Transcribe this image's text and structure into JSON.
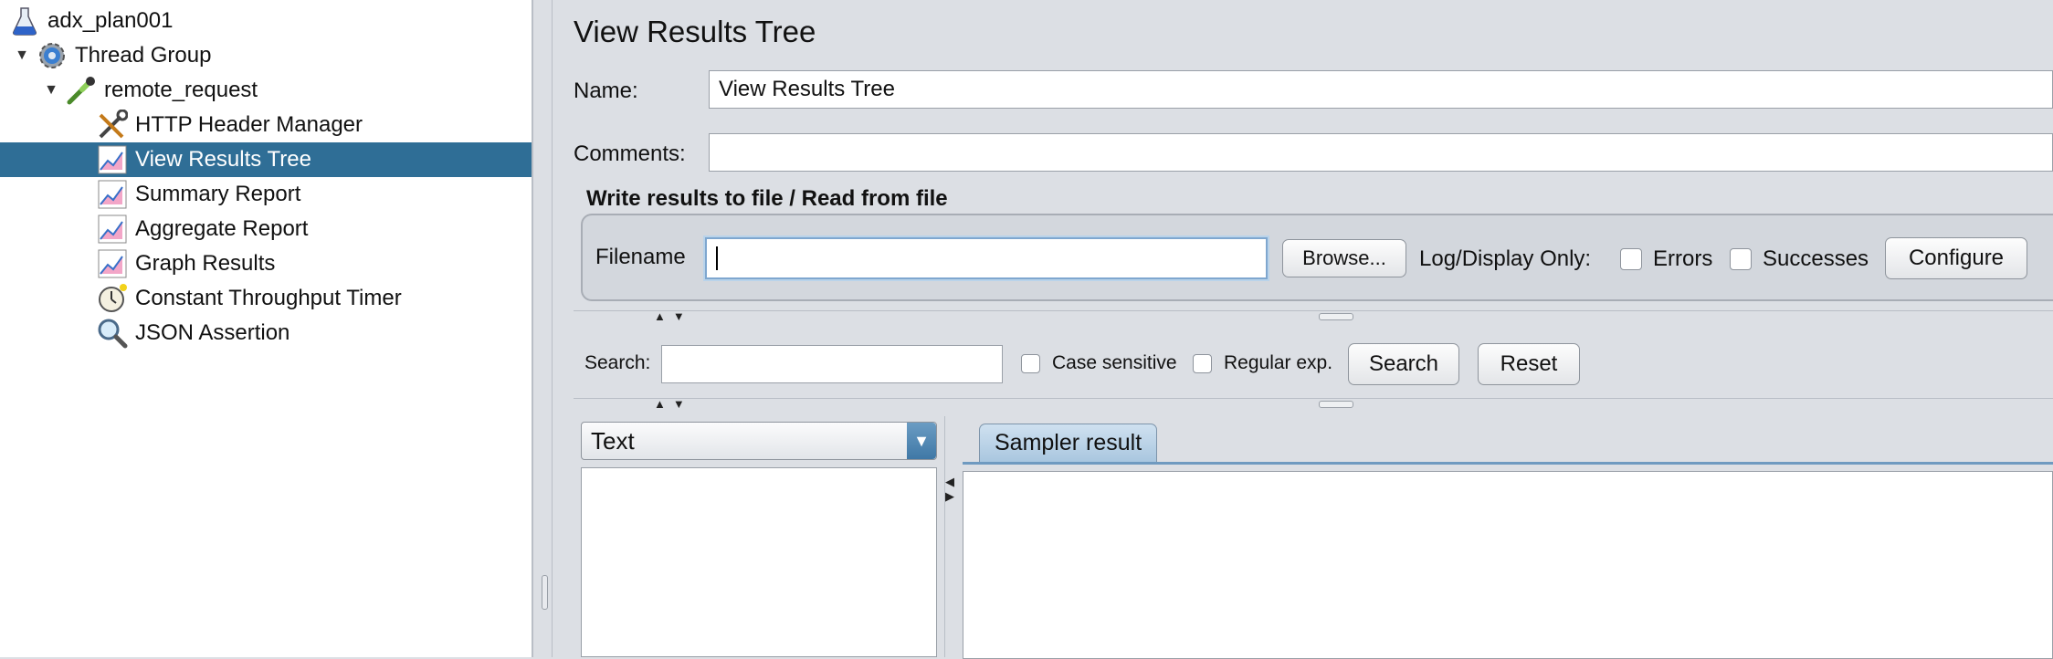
{
  "tree": {
    "items": [
      {
        "label": "adx_plan001",
        "icon": "flask-icon",
        "level": 0,
        "expanded": null,
        "selected": false
      },
      {
        "label": "Thread Group",
        "icon": "gear-icon",
        "level": 1,
        "expanded": true,
        "selected": false
      },
      {
        "label": "remote_request",
        "icon": "pipette-icon",
        "level": 2,
        "expanded": true,
        "selected": false
      },
      {
        "label": "HTTP Header Manager",
        "icon": "tools-icon",
        "level": 3,
        "expanded": null,
        "selected": false
      },
      {
        "label": "View Results Tree",
        "icon": "chart-listener-icon",
        "level": 3,
        "expanded": null,
        "selected": true
      },
      {
        "label": "Summary Report",
        "icon": "chart-listener-icon",
        "level": 3,
        "expanded": null,
        "selected": false
      },
      {
        "label": "Aggregate Report",
        "icon": "chart-listener-icon",
        "level": 3,
        "expanded": null,
        "selected": false
      },
      {
        "label": "Graph Results",
        "icon": "chart-listener-icon",
        "level": 3,
        "expanded": null,
        "selected": false
      },
      {
        "label": "Constant Throughput Timer",
        "icon": "stopwatch-icon",
        "level": 3,
        "expanded": null,
        "selected": false
      },
      {
        "label": "JSON Assertion",
        "icon": "magnifier-icon",
        "level": 3,
        "expanded": null,
        "selected": false
      }
    ]
  },
  "panel": {
    "title": "View Results Tree",
    "name_label": "Name:",
    "name_value": "View Results Tree",
    "comments_label": "Comments:",
    "comments_value": "",
    "file_section_title": "Write results to file / Read from file",
    "filename_label": "Filename",
    "filename_value": "",
    "browse_label": "Browse...",
    "log_display_label": "Log/Display Only:",
    "errors_label": "Errors",
    "errors_checked": false,
    "successes_label": "Successes",
    "successes_checked": false,
    "configure_label": "Configure"
  },
  "search": {
    "label": "Search:",
    "value": "",
    "case_sensitive_label": "Case sensitive",
    "case_sensitive_checked": false,
    "regex_label": "Regular exp.",
    "regex_checked": false,
    "search_button": "Search",
    "reset_button": "Reset"
  },
  "results": {
    "renderer_selected": "Text",
    "tabs": [
      {
        "label": "Sampler result",
        "active": true
      }
    ]
  },
  "colors": {
    "selection": "#2f6e96",
    "panel_bg": "#dcdfe4",
    "tab_active": "#a9c6df"
  }
}
